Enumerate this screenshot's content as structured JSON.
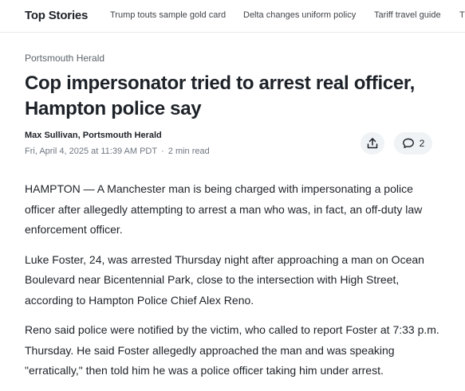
{
  "nav": {
    "brand": "Top Stories",
    "links": [
      "Trump touts sample gold card",
      "Delta changes uniform policy",
      "Tariff travel guide",
      "T"
    ]
  },
  "article": {
    "source": "Portsmouth Herald",
    "headline": "Cop impersonator tried to arrest real officer, Hampton police say",
    "byline": "Max Sullivan, Portsmouth Herald",
    "date": "Fri, April 4, 2025 at 11:39 AM PDT",
    "dot": "·",
    "read_time": "2 min read",
    "comment_count": "2",
    "paragraphs": [
      "HAMPTON — A Manchester man is being charged with impersonating a police officer after allegedly attempting to arrest a man who was, in fact, an off-duty law enforcement officer.",
      "Luke Foster, 24, was arrested Thursday night after approaching a man on Ocean Boulevard near Bicentennial Park, close to the intersection with High Street, according to Hampton Police Chief Alex Reno.",
      "Reno said police were notified by the victim, who called to report Foster at 7:33 p.m. Thursday. He said Foster allegedly approached the man and was speaking \"erratically,\" then told him he was a police officer taking him under arrest."
    ]
  },
  "icons": {
    "share": "share-icon",
    "comment": "comment-icon"
  }
}
